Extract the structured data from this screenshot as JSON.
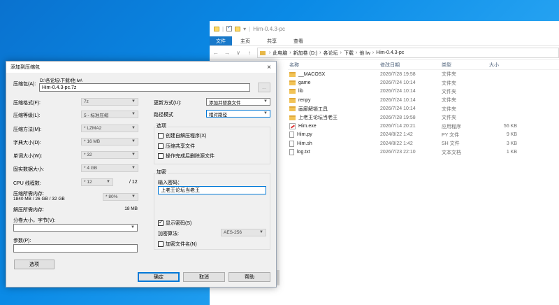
{
  "explorer": {
    "title": "Him-0.4.3-pc",
    "tabs": [
      "文件",
      "主页",
      "共享",
      "查看"
    ],
    "breadcrumb": [
      "此电脑",
      "新加卷 (D:)",
      "各论坛",
      "下载",
      "他 lw",
      "Him-0.4.3-pc"
    ],
    "columns": {
      "name": "名称",
      "date": "修改日期",
      "type": "类型",
      "size": "大小"
    },
    "files": [
      {
        "name": "__MACOSX",
        "date": "2026/7/28 19:58",
        "type": "文件夹",
        "size": "",
        "icon": "folder-icon"
      },
      {
        "name": "game",
        "date": "2026/7/24 10:14",
        "type": "文件夹",
        "size": "",
        "icon": "folder-icon"
      },
      {
        "name": "lib",
        "date": "2026/7/24 10:14",
        "type": "文件夹",
        "size": "",
        "icon": "folder-icon"
      },
      {
        "name": "renpy",
        "date": "2026/7/24 10:14",
        "type": "文件夹",
        "size": "",
        "icon": "folder-icon"
      },
      {
        "name": "画廊解锁工具",
        "date": "2026/7/24 10:14",
        "type": "文件夹",
        "size": "",
        "icon": "folder-icon"
      },
      {
        "name": "上老王论坛当老王",
        "date": "2026/7/28 19:58",
        "type": "文件夹",
        "size": "",
        "icon": "folder-icon"
      },
      {
        "name": "Him.exe",
        "date": "2026/7/14 20:21",
        "type": "应用程序",
        "size": "56 KB",
        "icon": "exe-icon"
      },
      {
        "name": "Him.py",
        "date": "2024/8/22 1:42",
        "type": "PY 文件",
        "size": "9 KB",
        "icon": "file-icon"
      },
      {
        "name": "Him.sh",
        "date": "2024/8/22 1:42",
        "type": "SH 文件",
        "size": "3 KB",
        "icon": "file-icon"
      },
      {
        "name": "log.txt",
        "date": "2026/7/23 22:10",
        "type": "文本文档",
        "size": "1 KB",
        "icon": "file-icon"
      }
    ]
  },
  "dialog": {
    "title": "添加到压缩包",
    "close": "×",
    "archive_label": "压缩包(A):",
    "archive_path": "D:\\各论坛\\下载\\他 lw\\",
    "archive_name": "Him-0.4.3-pc.7z",
    "browse": "...",
    "format_label": "压缩格式(F):",
    "format_value": "7z",
    "level_label": "压缩等级(L):",
    "level_value": "5 - 标准压缩",
    "method_label": "压缩方法(M):",
    "method_value": "* LZMA2",
    "dict_label": "字典大小(D):",
    "dict_value": "* 16 MB",
    "word_label": "单词大小(W):",
    "word_value": "* 32",
    "solid_label": "固实数据大小:",
    "solid_value": "* 4 GB",
    "cpu_label": "CPU 线程数:",
    "cpu_value": "* 12",
    "cpu_total": "/ 12",
    "mem_comp_label": "压缩所需内存:",
    "mem_comp_detail": "1840 MB / 26 GB / 32 GB",
    "mem_pct": "* 80%",
    "mem_decomp_label": "解压所需内存:",
    "mem_decomp_value": "18 MB",
    "split_label": "分卷大小，字节(V):",
    "params_label": "参数(P):",
    "options_btn": "选项",
    "update_label": "更新方式(U):",
    "update_value": "添加并替换文件",
    "pathmode_label": "路径模式",
    "pathmode_value": "相对路径",
    "options_group": "选项",
    "opt_sfx": "创建自解压程序(X)",
    "opt_shared": "压缩共享文件",
    "opt_delete": "操作完成后删除源文件",
    "enc_group": "加密",
    "pwd_label": "输入密码：",
    "pwd_value": "上老王论坛当老王",
    "show_pwd": "显示密码(S)",
    "enc_method_label": "加密算法:",
    "enc_method_value": "AES-256",
    "enc_names": "加密文件名(N)",
    "ok": "确定",
    "cancel": "取消",
    "help": "帮助"
  }
}
